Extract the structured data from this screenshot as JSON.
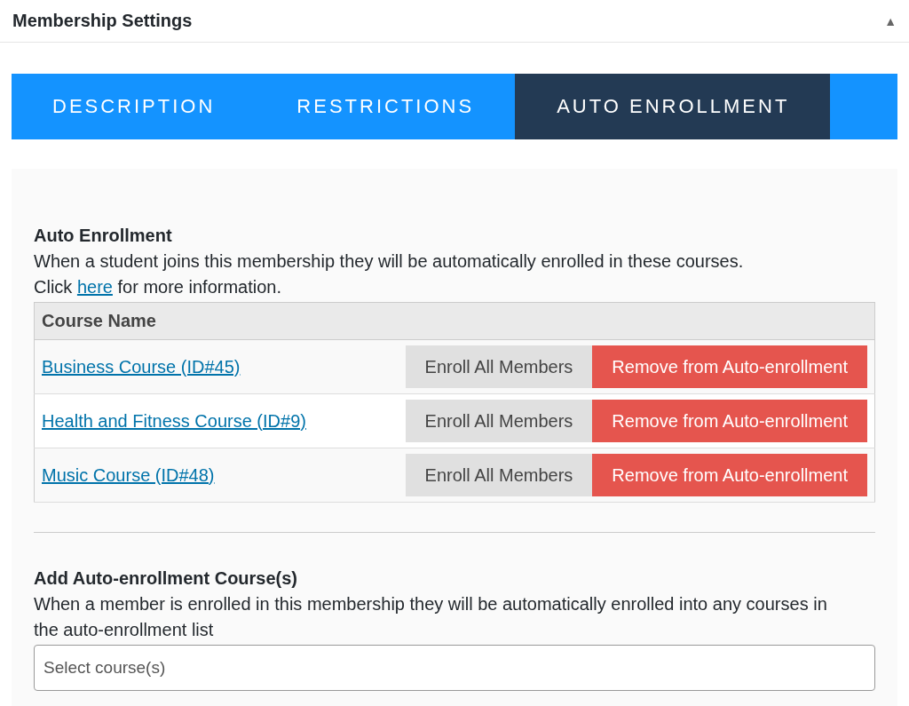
{
  "panel": {
    "title": "Membership Settings",
    "collapse_icon": "▲"
  },
  "tabs": [
    {
      "label": "DESCRIPTION",
      "selected": false
    },
    {
      "label": "RESTRICTIONS",
      "selected": false
    },
    {
      "label": "AUTO ENROLLMENT",
      "selected": true
    }
  ],
  "auto_enrollment": {
    "heading": "Auto Enrollment",
    "description": "When a student joins this membership they will be automatically enrolled in these courses.",
    "info_before": "Click",
    "info_link": "here",
    "info_after": "for more information.",
    "table": {
      "columns": [
        "Course Name"
      ],
      "rows": [
        {
          "course": "Business Course (ID#45)",
          "enroll_button": "Enroll All Members",
          "remove_button": "Remove from Auto-enrollment"
        },
        {
          "course": "Health and Fitness Course (ID#9)",
          "enroll_button": "Enroll All Members",
          "remove_button": "Remove from Auto-enrollment"
        },
        {
          "course": "Music Course (ID#48)",
          "enroll_button": "Enroll All Members",
          "remove_button": "Remove from Auto-enrollment"
        }
      ]
    }
  },
  "add_course": {
    "heading": "Add Auto-enrollment Course(s)",
    "description": "When a member is enrolled in this membership they will be automatically enrolled into any courses in the auto-enrollment list",
    "select": {
      "placeholder": "Select course(s)"
    }
  }
}
